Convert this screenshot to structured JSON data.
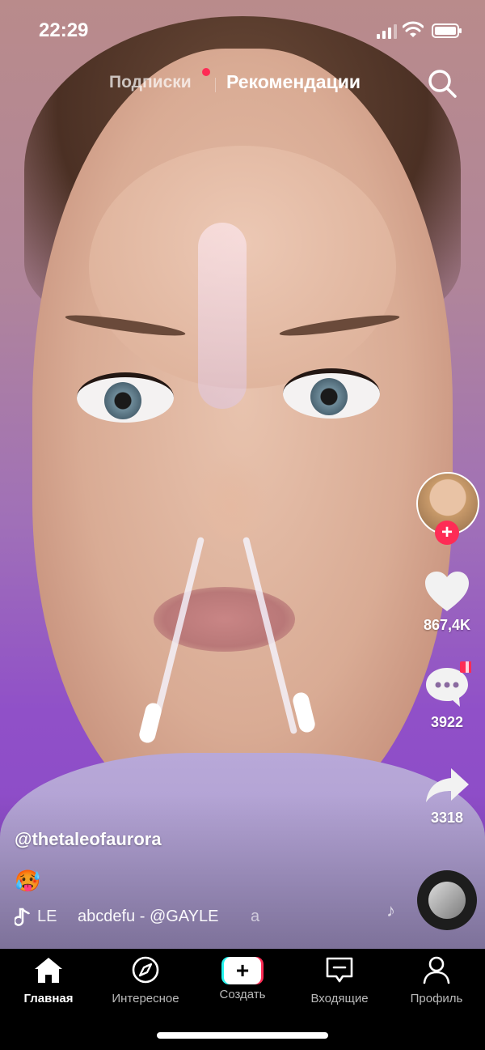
{
  "status_bar": {
    "time": "22:29"
  },
  "top_tabs": {
    "following": "Подписки",
    "for_you": "Рекомендации"
  },
  "actions": {
    "likes": "867,4K",
    "comments": "3922",
    "shares": "3318",
    "follow": "+"
  },
  "video": {
    "username": "@thetaleofaurora",
    "caption_emoji": "🥵",
    "music_prefix": "LE",
    "music_title": "abcdefu - @GAYLE",
    "music_suffix": "a"
  },
  "bottom_nav": {
    "items": [
      {
        "label": "Главная",
        "icon": "home-icon",
        "active": true
      },
      {
        "label": "Интересное",
        "icon": "compass-icon",
        "active": false
      },
      {
        "label": "Создать",
        "icon": "create-icon",
        "active": false
      },
      {
        "label": "Входящие",
        "icon": "inbox-icon",
        "active": false
      },
      {
        "label": "Профиль",
        "icon": "profile-icon",
        "active": false
      }
    ]
  },
  "colors": {
    "accent": "#fe2c55",
    "cyan": "#25f4ee"
  }
}
